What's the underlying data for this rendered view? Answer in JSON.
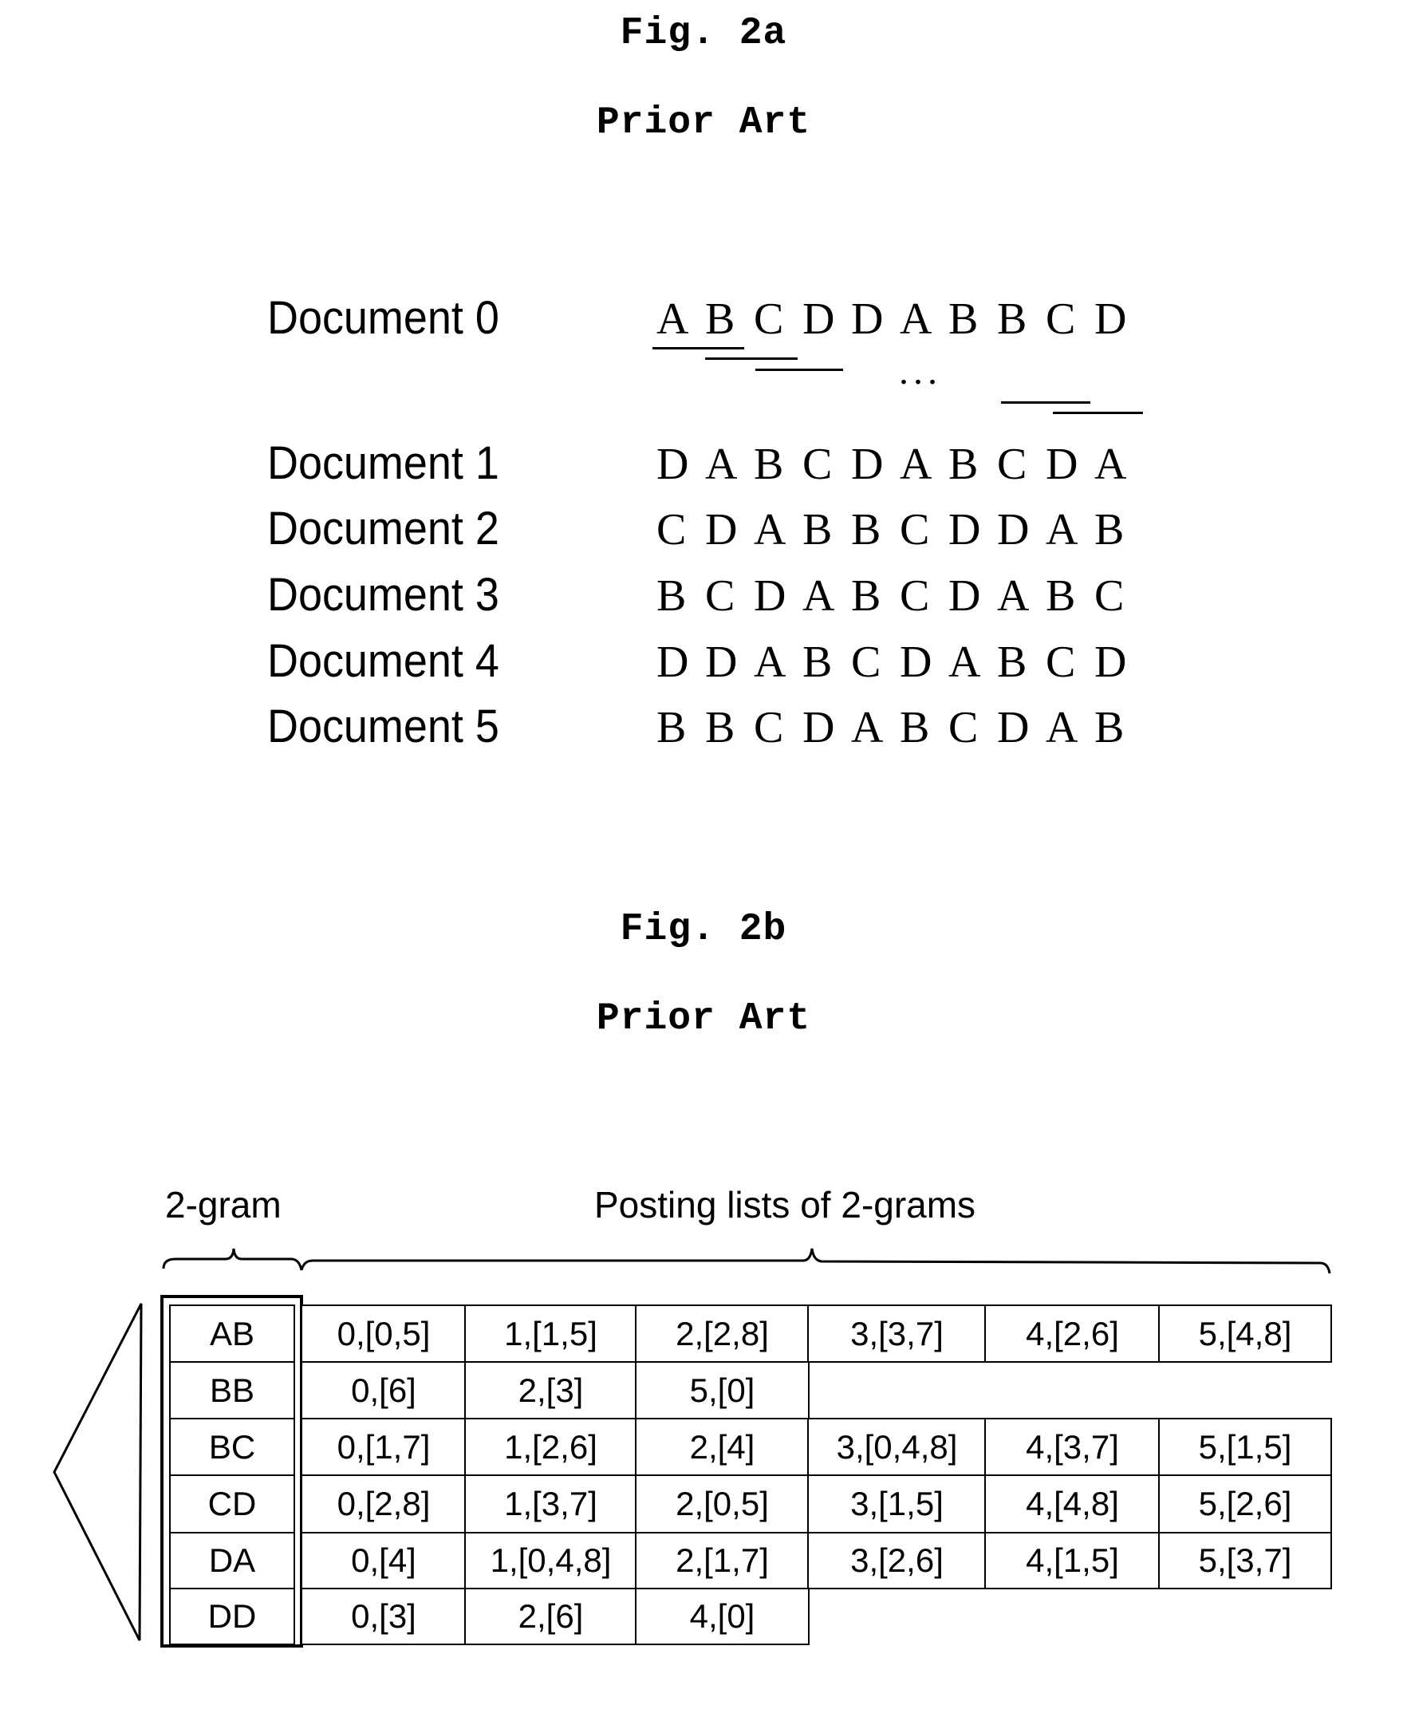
{
  "fig2a": {
    "title": "Fig. 2a",
    "subtitle": "Prior Art",
    "ellipsis": "...",
    "documents": [
      {
        "label": "Document 0",
        "sequence": [
          "A",
          "B",
          "C",
          "D",
          "D",
          "A",
          "B",
          "B",
          "C",
          "D"
        ]
      },
      {
        "label": "Document 1",
        "sequence": [
          "D",
          "A",
          "B",
          "C",
          "D",
          "A",
          "B",
          "C",
          "D",
          "A"
        ]
      },
      {
        "label": "Document 2",
        "sequence": [
          "C",
          "D",
          "A",
          "B",
          "B",
          "C",
          "D",
          "D",
          "A",
          "B"
        ]
      },
      {
        "label": "Document 3",
        "sequence": [
          "B",
          "C",
          "D",
          "A",
          "B",
          "C",
          "D",
          "A",
          "B",
          "C"
        ]
      },
      {
        "label": "Document 4",
        "sequence": [
          "D",
          "D",
          "A",
          "B",
          "C",
          "D",
          "A",
          "B",
          "C",
          "D"
        ]
      },
      {
        "label": "Document 5",
        "sequence": [
          "B",
          "B",
          "C",
          "D",
          "A",
          "B",
          "C",
          "D",
          "A",
          "B"
        ]
      }
    ]
  },
  "fig2b": {
    "title": "Fig. 2b",
    "subtitle": "Prior Art",
    "gram_header": "2-gram",
    "postings_header": "Posting lists of 2-grams",
    "rows": [
      {
        "gram": "AB",
        "postings": [
          "0,[0,5]",
          "1,[1,5]",
          "2,[2,8]",
          "3,[3,7]",
          "4,[2,6]",
          "5,[4,8]"
        ]
      },
      {
        "gram": "BB",
        "postings": [
          "0,[6]",
          "2,[3]",
          "5,[0]"
        ]
      },
      {
        "gram": "BC",
        "postings": [
          "0,[1,7]",
          "1,[2,6]",
          "2,[4]",
          "3,[0,4,8]",
          "4,[3,7]",
          "5,[1,5]"
        ]
      },
      {
        "gram": "CD",
        "postings": [
          "0,[2,8]",
          "1,[3,7]",
          "2,[0,5]",
          "3,[1,5]",
          "4,[4,8]",
          "5,[2,6]"
        ]
      },
      {
        "gram": "DA",
        "postings": [
          "0,[4]",
          "1,[0,4,8]",
          "2,[1,7]",
          "3,[2,6]",
          "4,[1,5]",
          "5,[3,7]"
        ]
      },
      {
        "gram": "DD",
        "postings": [
          "0,[3]",
          "2,[6]",
          "4,[0]"
        ]
      }
    ]
  }
}
